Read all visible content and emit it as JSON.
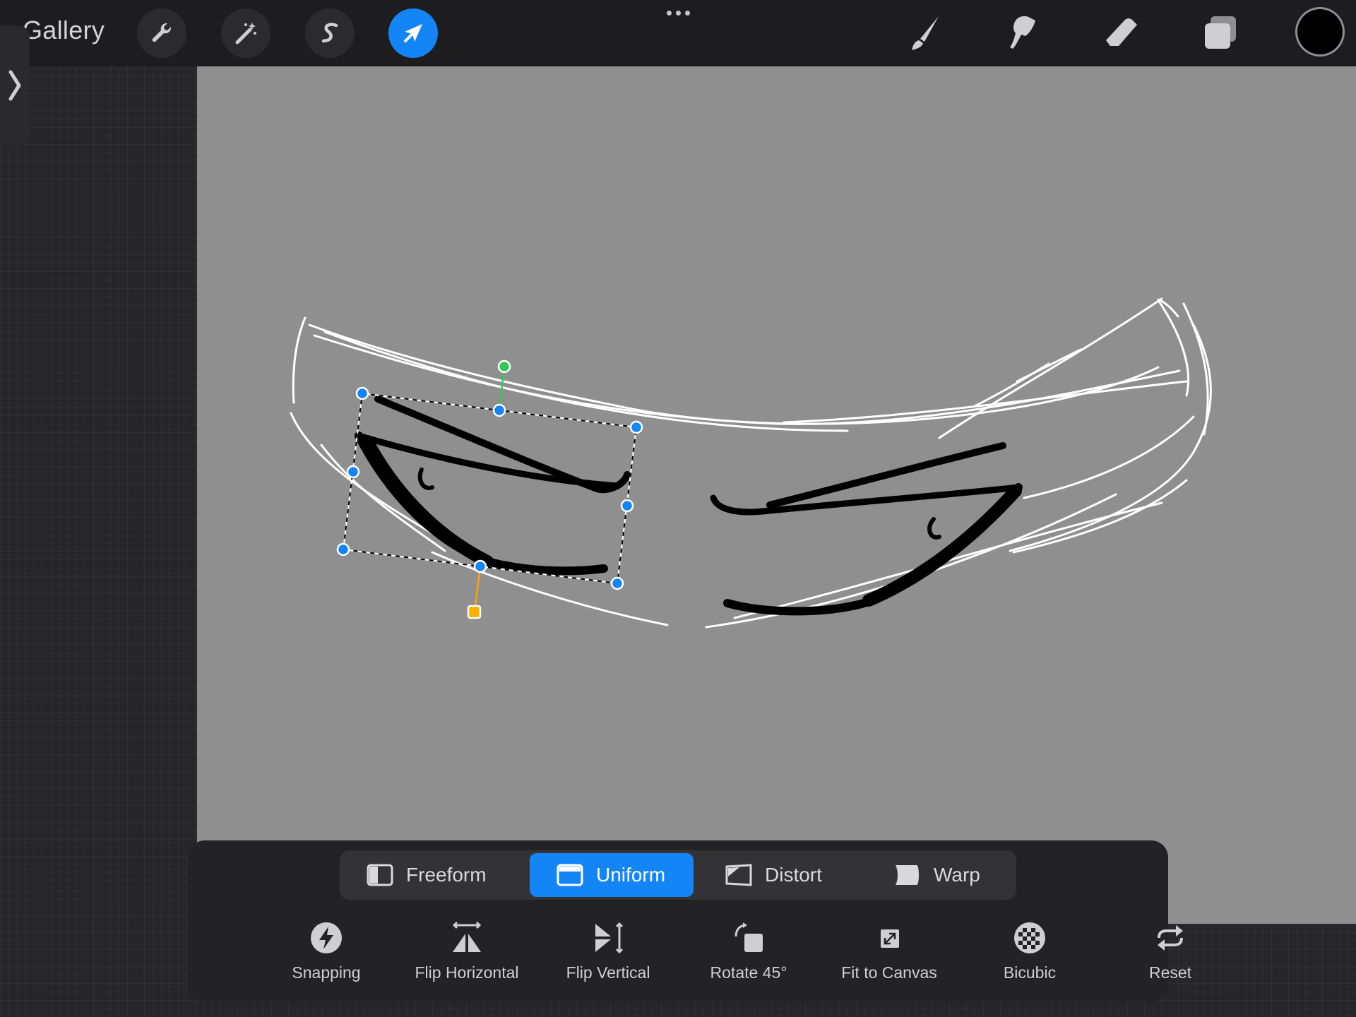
{
  "header": {
    "gallery_label": "Gallery",
    "left_tools": [
      {
        "name": "actions",
        "icon": "wrench-icon"
      },
      {
        "name": "adjustments",
        "icon": "magic-wand-icon"
      },
      {
        "name": "selection",
        "icon": "selection-s-icon"
      },
      {
        "name": "transform",
        "icon": "transform-arrow-icon",
        "active": true
      }
    ],
    "right_tools": [
      {
        "name": "brush",
        "icon": "brush-icon"
      },
      {
        "name": "smudge",
        "icon": "smudge-icon"
      },
      {
        "name": "eraser",
        "icon": "eraser-icon"
      },
      {
        "name": "layers",
        "icon": "layers-icon"
      }
    ],
    "current_color": "#000000",
    "accent_color": "#1485f7"
  },
  "transform": {
    "modes": [
      {
        "label": "Freeform",
        "icon": "freeform-icon"
      },
      {
        "label": "Uniform",
        "icon": "uniform-icon",
        "selected": true
      },
      {
        "label": "Distort",
        "icon": "distort-icon"
      },
      {
        "label": "Warp",
        "icon": "warp-icon"
      }
    ],
    "actions": [
      {
        "label": "Snapping",
        "icon": "snapping-bolt-icon"
      },
      {
        "label": "Flip Horizontal",
        "icon": "flip-horizontal-icon"
      },
      {
        "label": "Flip Vertical",
        "icon": "flip-vertical-icon"
      },
      {
        "label": "Rotate 45°",
        "icon": "rotate-icon"
      },
      {
        "label": "Fit to Canvas",
        "icon": "fit-to-canvas-icon"
      },
      {
        "label": "Bicubic",
        "icon": "bicubic-icon"
      },
      {
        "label": "Reset",
        "icon": "reset-icon"
      }
    ]
  }
}
